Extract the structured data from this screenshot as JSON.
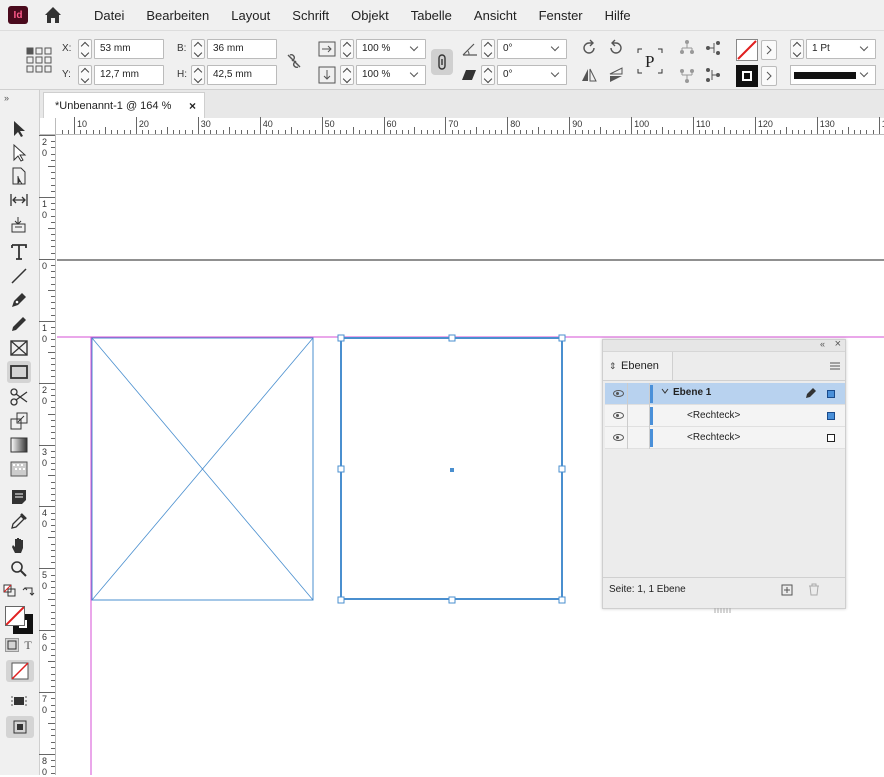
{
  "app": {
    "logo": "Id"
  },
  "menu": [
    "Datei",
    "Bearbeiten",
    "Layout",
    "Schrift",
    "Objekt",
    "Tabelle",
    "Ansicht",
    "Fenster",
    "Hilfe"
  ],
  "control": {
    "x_label": "X:",
    "x_value": "53 mm",
    "y_label": "Y:",
    "y_value": "12,7 mm",
    "w_label": "B:",
    "w_value": "36 mm",
    "h_label": "H:",
    "h_value": "42,5 mm",
    "scale_x": "100 %",
    "scale_y": "100 %",
    "angle": "0°",
    "shear": "0°",
    "stroke_weight": "1 Pt"
  },
  "document": {
    "tab_title": "*Unbenannt-1 @ 164 %",
    "close": "×"
  },
  "ruler": {
    "h_labels": [
      "10",
      "20",
      "30",
      "40",
      "50",
      "60",
      "70",
      "80",
      "90",
      "100",
      "110",
      "120",
      "130",
      "1"
    ],
    "v_labels": [
      [
        "2",
        "0"
      ],
      [
        "1",
        "0"
      ],
      [
        "0"
      ],
      [
        "1",
        "0"
      ],
      [
        "2",
        "0"
      ],
      [
        "3",
        "0"
      ],
      [
        "4",
        "0"
      ],
      [
        "5",
        "0"
      ],
      [
        "6",
        "0"
      ],
      [
        "7",
        "0"
      ],
      [
        "8",
        "0"
      ]
    ]
  },
  "layers_panel": {
    "tab": "Ebenen",
    "rows": [
      {
        "name": "Ebene 1",
        "selected": true
      },
      {
        "name": "<Rechteck>",
        "selected": false
      },
      {
        "name": "<Rechteck>",
        "selected": false
      }
    ],
    "footer": "Seite: 1, 1 Ebene"
  },
  "colors": {
    "accent": "#4a90d9",
    "margin": "#d44fd4",
    "frame": "#4a8fcf",
    "layer_selected": "#b8d2ef"
  }
}
